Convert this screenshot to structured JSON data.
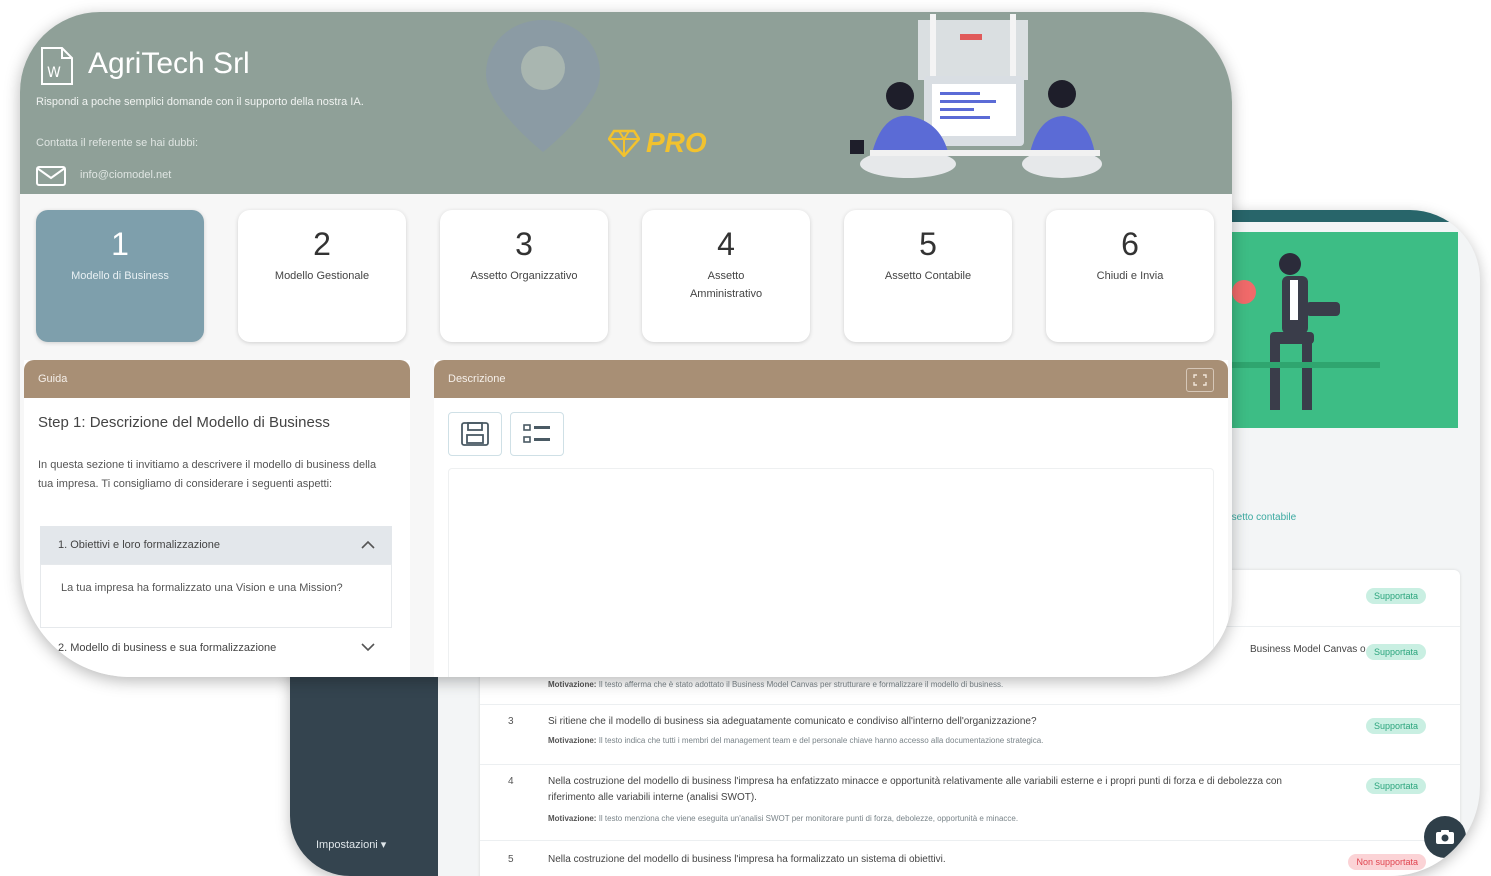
{
  "brand": {
    "name": "AgriTech Srl",
    "subtitle": "Rispondi a poche semplici domande con il supporto della nostra IA.",
    "contact_hint": "Contatta il referente se hai dubbi:",
    "email": "info@ciomodel.net",
    "pro_label": "PRO"
  },
  "steps": [
    {
      "num": "1",
      "label": "Modello di Business",
      "active": true
    },
    {
      "num": "2",
      "label": "Modello Gestionale",
      "active": false
    },
    {
      "num": "3",
      "label": "Assetto Organizzativo",
      "active": false
    },
    {
      "num": "4",
      "label": "Assetto Amministrativo",
      "active": false
    },
    {
      "num": "5",
      "label": "Assetto Contabile",
      "active": false
    },
    {
      "num": "6",
      "label": "Chiudi e Invia",
      "active": false
    }
  ],
  "guide": {
    "title": "Guida",
    "heading": "Step 1: Descrizione del Modello di Business",
    "intro": "In questa sezione ti invitiamo a descrivere il modello di business della tua impresa. Ti consigliamo di considerare i seguenti aspetti:",
    "accordion": [
      {
        "label": "1. Obiettivi e loro formalizzazione",
        "body": "La tua impresa ha formalizzato una Vision e una Mission?",
        "open": true
      },
      {
        "label": "2. Modello di business e sua formalizzazione",
        "open": false
      }
    ]
  },
  "description": {
    "title": "Descrizione"
  },
  "back_window": {
    "settings_label": "Impostazioni ▾",
    "link_text": "Assetto contabile",
    "rows": [
      {
        "num": "",
        "text": "",
        "motivation": "",
        "status": "Supportata"
      },
      {
        "num": "",
        "text": "Business Model Canvas o",
        "motivation": "",
        "status": "Supportata"
      },
      {
        "num": "",
        "text": "",
        "motivation_label": "Motivazione:",
        "motivation": "Il testo afferma che è stato adottato il Business Model Canvas per strutturare e formalizzare il modello di business.",
        "status": ""
      },
      {
        "num": "3",
        "text": "Si ritiene che il modello di business sia adeguatamente comunicato e condiviso all'interno dell'organizzazione?",
        "motivation_label": "Motivazione:",
        "motivation": "Il testo indica che tutti i membri del management team e del personale chiave hanno accesso alla documentazione strategica.",
        "status": "Supportata"
      },
      {
        "num": "4",
        "text": "Nella costruzione del modello di business l'impresa ha enfatizzato minacce e opportunità relativamente alle variabili esterne e i propri punti di forza e di debolezza con riferimento alle variabili interne (analisi SWOT).",
        "motivation_label": "Motivazione:",
        "motivation": "Il testo menziona che viene eseguita un'analisi SWOT per monitorare punti di forza, debolezze, opportunità e minacce.",
        "status": "Supportata"
      },
      {
        "num": "5",
        "text": "Nella costruzione del modello di business l'impresa ha formalizzato un sistema di obiettivi.",
        "motivation": "",
        "status": "Non supportata"
      }
    ]
  },
  "colors": {
    "header_bg": "#8fa098",
    "active_step": "#7e9fac",
    "panel_header": "#a88f75",
    "pro_gold": "#f2c22e",
    "supported": "#2ca57d",
    "not_supported": "#e0444f"
  }
}
